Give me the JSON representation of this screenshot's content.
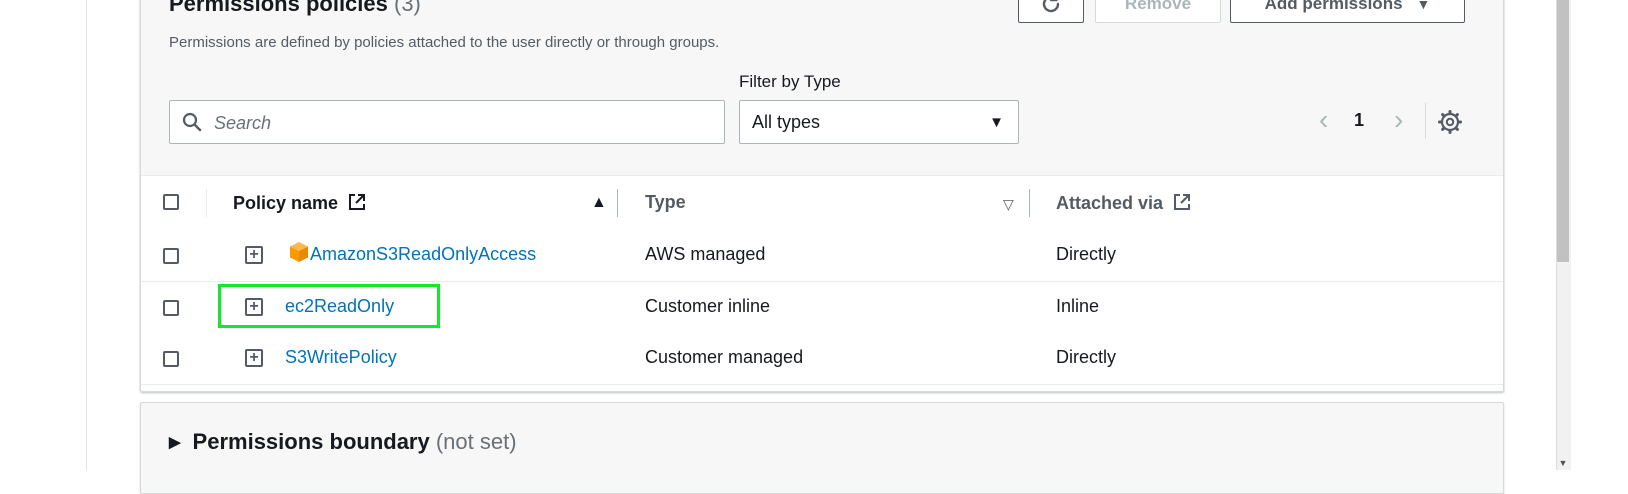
{
  "permissions": {
    "title": "Permissions policies",
    "count": "(3)",
    "description": "Permissions are defined by policies attached to the user directly or through groups.",
    "buttons": {
      "refresh_icon": "refresh-icon",
      "remove": "Remove",
      "add_permissions": "Add permissions"
    },
    "filter": {
      "label": "Filter by Type",
      "selected": "All types",
      "options_visible": [
        "All types"
      ]
    },
    "search": {
      "placeholder": "Search",
      "value": ""
    },
    "pagination": {
      "current_page": "1"
    },
    "table": {
      "columns": [
        "Policy name",
        "Type",
        "Attached via"
      ],
      "sort": {
        "column": "Policy name",
        "direction": "ascending"
      },
      "rows": [
        {
          "name": "AmazonS3ReadOnlyAccess",
          "type": "AWS managed",
          "attached_via": "Directly",
          "icon": "aws-managed-policy-icon"
        },
        {
          "name": "ec2ReadOnly",
          "type": "Customer inline",
          "attached_via": "Inline",
          "highlighted": true
        },
        {
          "name": "S3WritePolicy",
          "type": "Customer managed",
          "attached_via": "Directly"
        }
      ]
    }
  },
  "boundary": {
    "title": "Permissions boundary",
    "status": "(not set)"
  },
  "colors": {
    "link": "#0073bb",
    "highlight": "#17e62b",
    "aws_orange": "#ff9900",
    "header_bg": "#f7f7f7"
  }
}
